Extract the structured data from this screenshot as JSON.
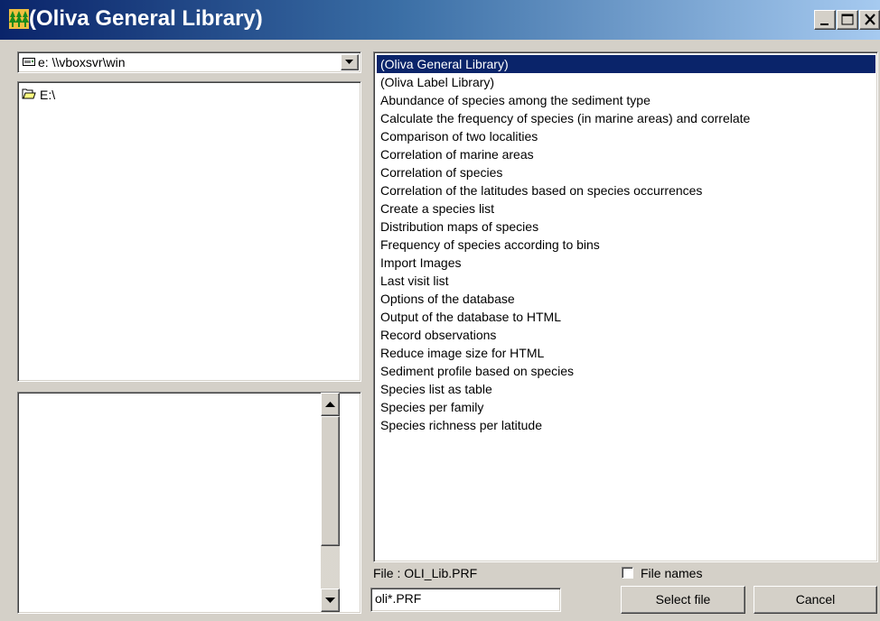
{
  "window": {
    "title": "(Oliva General Library)",
    "buttons": {
      "minimize": "minimize",
      "maximize": "maximize",
      "close": "close"
    },
    "icon": "tree-icon"
  },
  "drive_selector": {
    "value": "e: \\\\vboxsvr\\win",
    "icon": "network-drive-icon"
  },
  "folders": {
    "items": [
      {
        "label": "E:\\",
        "icon": "open-folder-icon"
      }
    ]
  },
  "library_list": {
    "selected_index": 0,
    "items": [
      "(Oliva General Library)",
      "(Oliva Label Library)",
      "Abundance of species among the sediment type",
      "Calculate the frequency of species (in marine areas) and correlate",
      "Comparison of two localities",
      "Correlation of marine areas",
      "Correlation of species",
      "Correlation of the latitudes based on species occurrences",
      "Create a species list",
      "Distribution maps of species",
      "Frequency of species according to bins",
      "Import Images",
      "Last visit list",
      "Options of the database",
      "Output of the database to HTML",
      "Record observations",
      "Reduce image size for HTML",
      "Sediment profile based on species",
      "Species list as table",
      "Species per family",
      "Species richness per latitude"
    ]
  },
  "footer": {
    "file_label": "File : OLI_Lib.PRF",
    "file_names_label": "File names",
    "file_names_checked": false,
    "filter_value": "oli*.PRF",
    "select_button": "Select file",
    "cancel_button": "Cancel"
  },
  "colors": {
    "title_gradient_start": "#0a246a",
    "title_gradient_end": "#a6caf0",
    "selection": "#0a246a",
    "face": "#d4d0c8"
  }
}
